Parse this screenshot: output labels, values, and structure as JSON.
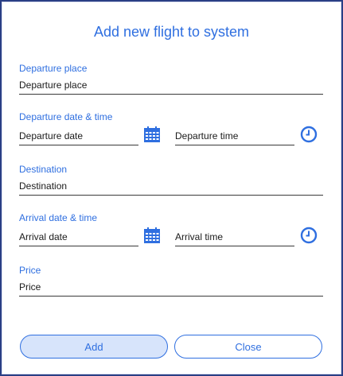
{
  "dialog": {
    "title": "Add new flight to system"
  },
  "departure_place": {
    "label": "Departure place",
    "placeholder": "Departure place",
    "value": ""
  },
  "departure_datetime": {
    "label": "Departure date & time",
    "date_placeholder": "Departure date",
    "time_placeholder": "Departure time",
    "date_icon": "calendar-icon",
    "time_icon": "clock-icon"
  },
  "destination": {
    "label": "Destination",
    "placeholder": "Destination",
    "value": ""
  },
  "arrival_datetime": {
    "label": "Arrival date & time",
    "date_placeholder": "Arrival date",
    "time_placeholder": "Arrival time",
    "date_icon": "calendar-icon",
    "time_icon": "clock-icon"
  },
  "price": {
    "label": "Price",
    "placeholder": "Price",
    "value": ""
  },
  "buttons": {
    "add_label": "Add",
    "close_label": "Close"
  },
  "colors": {
    "accent": "#2f6fe0",
    "border": "#2a3f85",
    "add_button_bg": "#d7e4fb"
  }
}
